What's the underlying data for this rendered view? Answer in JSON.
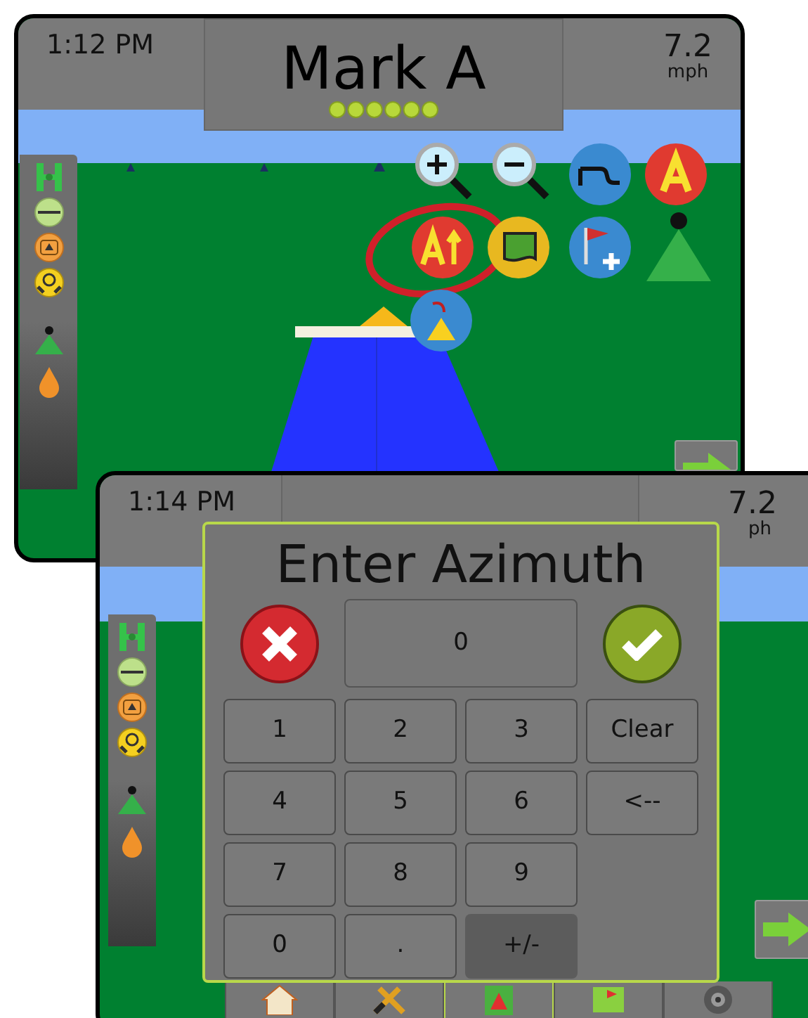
{
  "screens": [
    {
      "time": "1:12 PM",
      "title": "Mark A",
      "speed": "7.2",
      "unit": "mph"
    },
    {
      "time": "1:14 PM",
      "speed": "7.2",
      "unit": "ph",
      "dialog": {
        "title": "Enter Azimuth",
        "value": "0",
        "keypad": [
          [
            {
              "label": "1",
              "dimmed": false
            },
            {
              "label": "2",
              "dimmed": false
            },
            {
              "label": "3",
              "dimmed": false
            },
            {
              "label": "Clear",
              "dimmed": false
            }
          ],
          [
            {
              "label": "4",
              "dimmed": false
            },
            {
              "label": "5",
              "dimmed": false
            },
            {
              "label": "6",
              "dimmed": false
            },
            {
              "label": "<--",
              "dimmed": false
            }
          ],
          [
            {
              "label": "7",
              "dimmed": false
            },
            {
              "label": "8",
              "dimmed": false
            },
            {
              "label": "9",
              "dimmed": false
            }
          ],
          [
            {
              "label": "0",
              "dimmed": false
            },
            {
              "label": ".",
              "dimmed": false
            },
            {
              "label": "+/-",
              "dimmed": true
            }
          ]
        ]
      },
      "tabs": [
        {
          "selected": false
        },
        {
          "selected": false
        },
        {
          "selected": true
        },
        {
          "selected": false
        },
        {
          "selected": false
        }
      ]
    }
  ]
}
